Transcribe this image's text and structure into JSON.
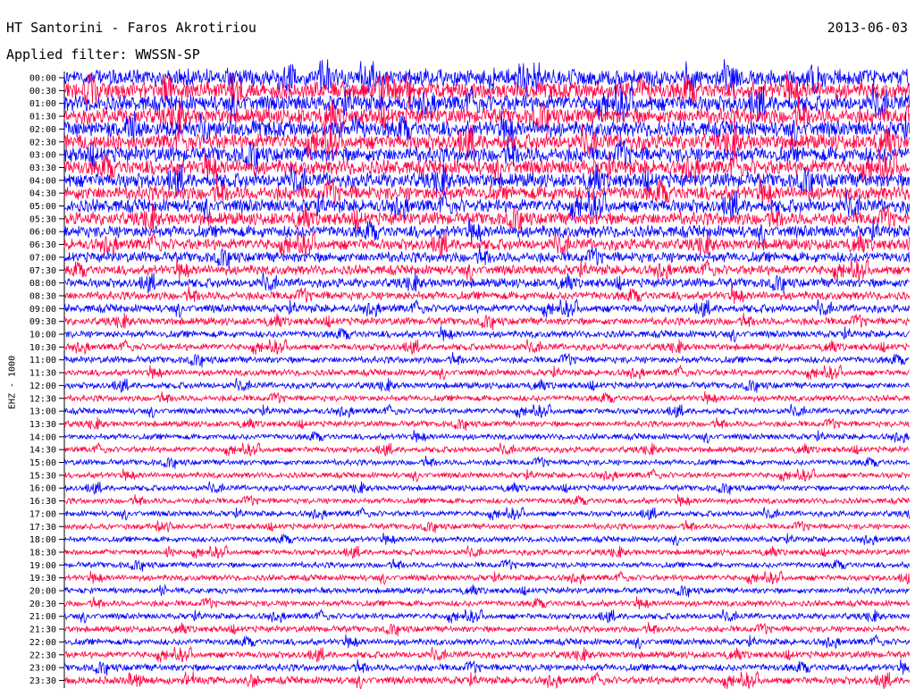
{
  "header": {
    "title": "HT Santorini - Faros Akrotiriou",
    "date": "2013-06-03",
    "filter": "Applied filter: WWSSN-SP"
  },
  "chart_data": {
    "type": "line",
    "ylabel": "EHZ - 1000",
    "row_labels": [
      "00:00",
      "00:30",
      "01:00",
      "01:30",
      "02:00",
      "02:30",
      "03:00",
      "03:30",
      "04:00",
      "04:30",
      "05:00",
      "05:30",
      "06:00",
      "06:30",
      "07:00",
      "07:30",
      "08:00",
      "08:30",
      "09:00",
      "09:30",
      "10:00",
      "10:30",
      "11:00",
      "11:30",
      "12:00",
      "12:30",
      "13:00",
      "13:30",
      "14:00",
      "14:30",
      "15:00",
      "15:30",
      "16:00",
      "16:30",
      "17:00",
      "17:30",
      "18:00",
      "18:30",
      "19:00",
      "19:30",
      "20:00",
      "20:30",
      "21:00",
      "21:30",
      "22:00",
      "22:30",
      "23:00",
      "23:30"
    ],
    "colors": [
      "#0000ff",
      "#ff0040"
    ],
    "relative_amplitude": [
      1.0,
      1.0,
      0.97,
      0.95,
      0.95,
      0.95,
      0.92,
      0.9,
      0.88,
      0.85,
      0.8,
      0.78,
      0.72,
      0.68,
      0.62,
      0.58,
      0.55,
      0.5,
      0.48,
      0.45,
      0.42,
      0.4,
      0.4,
      0.38,
      0.38,
      0.36,
      0.36,
      0.35,
      0.35,
      0.35,
      0.34,
      0.34,
      0.34,
      0.34,
      0.34,
      0.34,
      0.34,
      0.34,
      0.34,
      0.35,
      0.35,
      0.36,
      0.36,
      0.37,
      0.38,
      0.4,
      0.42,
      0.45
    ]
  }
}
